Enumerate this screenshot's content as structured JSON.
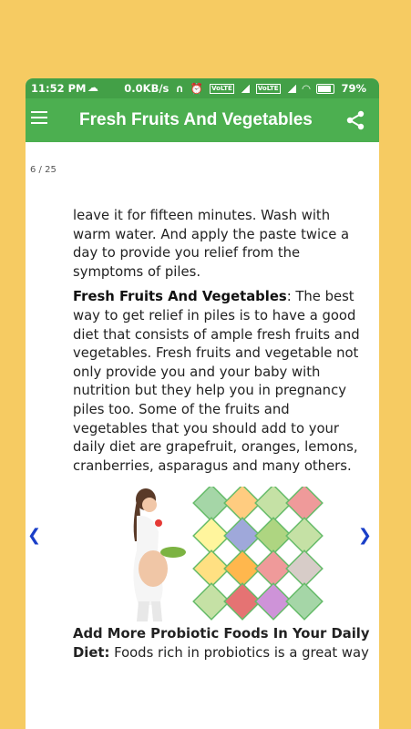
{
  "status": {
    "time": "11:52 PM",
    "speed": "0.0KB/s",
    "vo1": "VoLTE",
    "vo2": "VoLTE",
    "battery": "79%"
  },
  "toolbar": {
    "title": "Fresh Fruits And Vegetables"
  },
  "content": {
    "page_counter": "6 / 25",
    "prev_arrow": "❮",
    "next_arrow": "❯",
    "para1": "leave it for fifteen minutes. Wash with warm water. And apply the paste twice a day to provide you relief from the symptoms of piles.",
    "para2_bold": "Fresh Fruits And Vegetables",
    "para2_text": ": The best way to get relief in piles is to have a good diet that consists of ample fresh fruits and vegetables. Fresh fruits and vegetable not only provide you and your baby with nutrition but they help you in pregnancy piles too. Some of the fruits and vegetables that you should add to your daily diet are grapefruit, oranges, lemons, cranberries, asparagus and many others.",
    "para3_bold": "Add More Probiotic Foods In Your Daily Diet:",
    "para3_text": " Foods rich in probiotics is a great way"
  },
  "colors": {
    "background": "#F6CB62",
    "statusbar": "#43A047",
    "toolbar": "#4CAF50",
    "arrow": "#1A3FC8"
  }
}
